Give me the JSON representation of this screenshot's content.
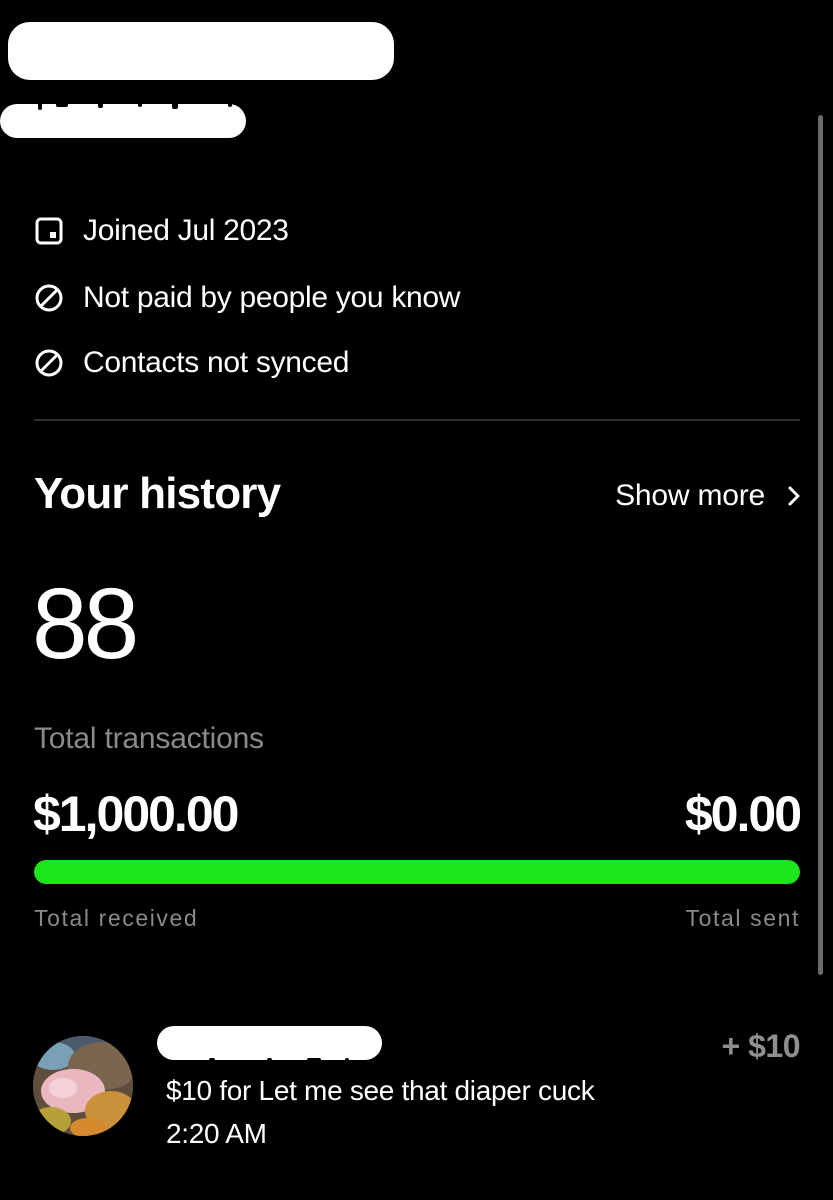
{
  "profile": {
    "info": [
      {
        "icon": "calendar-icon",
        "label": "Joined Jul 2023"
      },
      {
        "icon": "prohibited-icon",
        "label": "Not paid by people you know"
      },
      {
        "icon": "prohibited-icon",
        "label": "Contacts not synced"
      }
    ]
  },
  "history": {
    "title": "Your history",
    "show_more_label": "Show more",
    "total_transactions": "88",
    "total_transactions_label": "Total transactions",
    "total_received": "$1,000.00",
    "total_sent": "$0.00",
    "received_label": "Total received",
    "sent_label": "Total sent",
    "received_share": 1.0,
    "bar_color": "#1be51b"
  },
  "transactions": [
    {
      "amount": "+ $10",
      "note": "$10 for Let me see that diaper cuck",
      "time": "2:20 AM",
      "amount_color": "#8f8f8f"
    }
  ]
}
